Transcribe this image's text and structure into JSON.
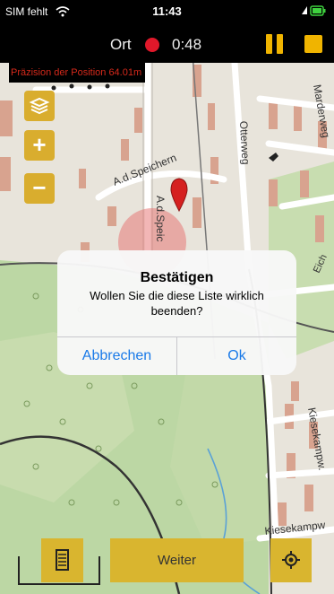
{
  "status_bar": {
    "carrier": "SIM fehlt",
    "time": "11:43"
  },
  "recording": {
    "label": "Ort",
    "elapsed": "0:48"
  },
  "precision": "Präzision der Position 64.01m",
  "map": {
    "streets": [
      "A.d.Speichern",
      "A.d.Speic",
      "Otterweg",
      "Marderweg",
      "Kiesekampw.",
      "Kiesekampw",
      "Eich"
    ],
    "zoom_in_label": "+",
    "zoom_out_label": "−"
  },
  "dialog": {
    "title": "Bestätigen",
    "message": "Wollen Sie die diese Liste wirklich beenden?",
    "cancel_label": "Abbrechen",
    "ok_label": "Ok"
  },
  "footer": {
    "next_label": "Weiter"
  }
}
